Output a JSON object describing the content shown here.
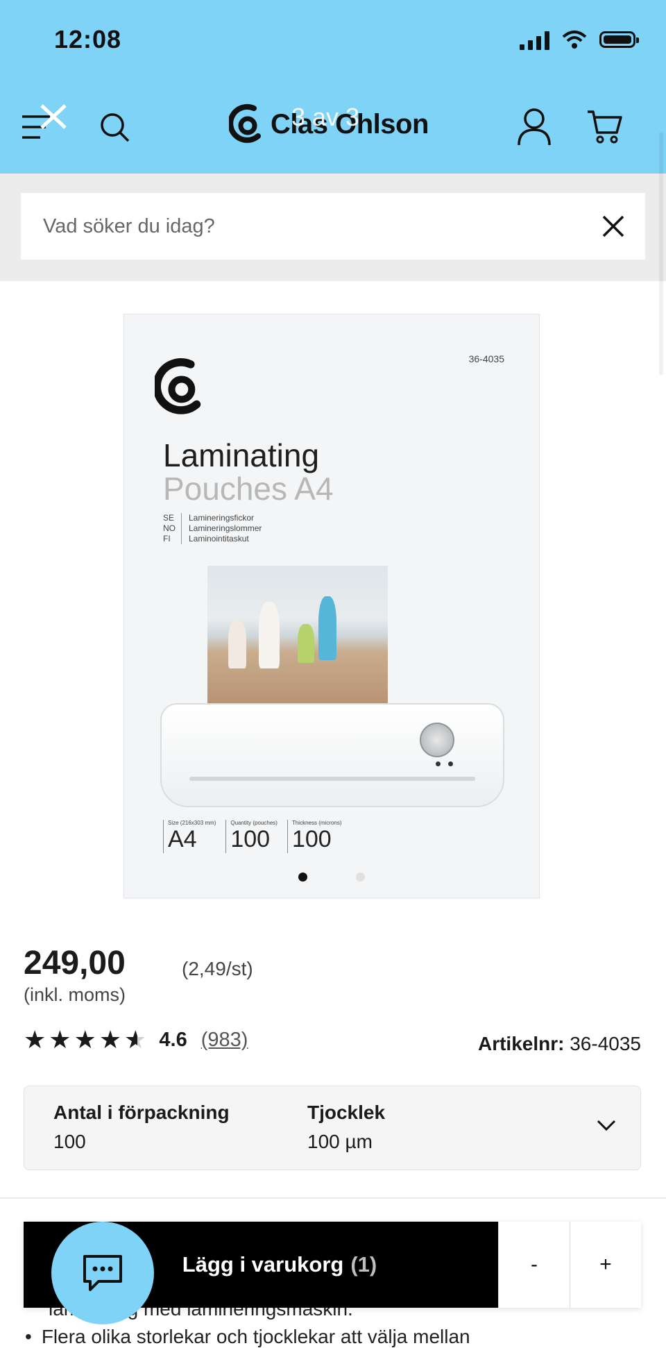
{
  "status_bar": {
    "time": "12:08"
  },
  "header": {
    "brand": "Clas Ohlson",
    "image_counter": "3 av 3"
  },
  "search": {
    "placeholder": "Vad söker du idag?"
  },
  "product_image": {
    "code": "36-4035",
    "title_line1": "Laminating",
    "title_line2": "Pouches A4",
    "languages": [
      {
        "code": "SE",
        "text": "Lamineringsfickor"
      },
      {
        "code": "NO",
        "text": "Lamineringslommer"
      },
      {
        "code": "FI",
        "text": "Laminointitaskut"
      }
    ],
    "specs": [
      {
        "label": "Size (216x303 mm)",
        "value": "A4"
      },
      {
        "label": "Quantity (pouches)",
        "value": "100"
      },
      {
        "label": "Thickness (microns)",
        "value": "100"
      }
    ],
    "carousel": {
      "active_index": 0,
      "total": 2
    }
  },
  "price": {
    "amount": "249,00",
    "unit_price": "(2,49/st)",
    "vat_note": "(inkl. moms)"
  },
  "rating": {
    "value": "4.6",
    "count": "(983)",
    "stars": 4.6
  },
  "article": {
    "label": "Artikelnr:",
    "number": "36-4035"
  },
  "specs": [
    {
      "label": "Antal i förpackning",
      "value": "100"
    },
    {
      "label": "Tjocklek",
      "value": "100 µm"
    }
  ],
  "cart": {
    "label": "Lägg i varukorg",
    "count": "(1)",
    "minus": "-",
    "plus": "+"
  },
  "description": {
    "partial_line": "laminering med lamineringsmaskin.",
    "bullet": "Flera olika storlekar och tjocklekar att välja mellan"
  },
  "colors": {
    "header_bg": "#7fd3f7",
    "cart_button_bg": "#000000"
  }
}
